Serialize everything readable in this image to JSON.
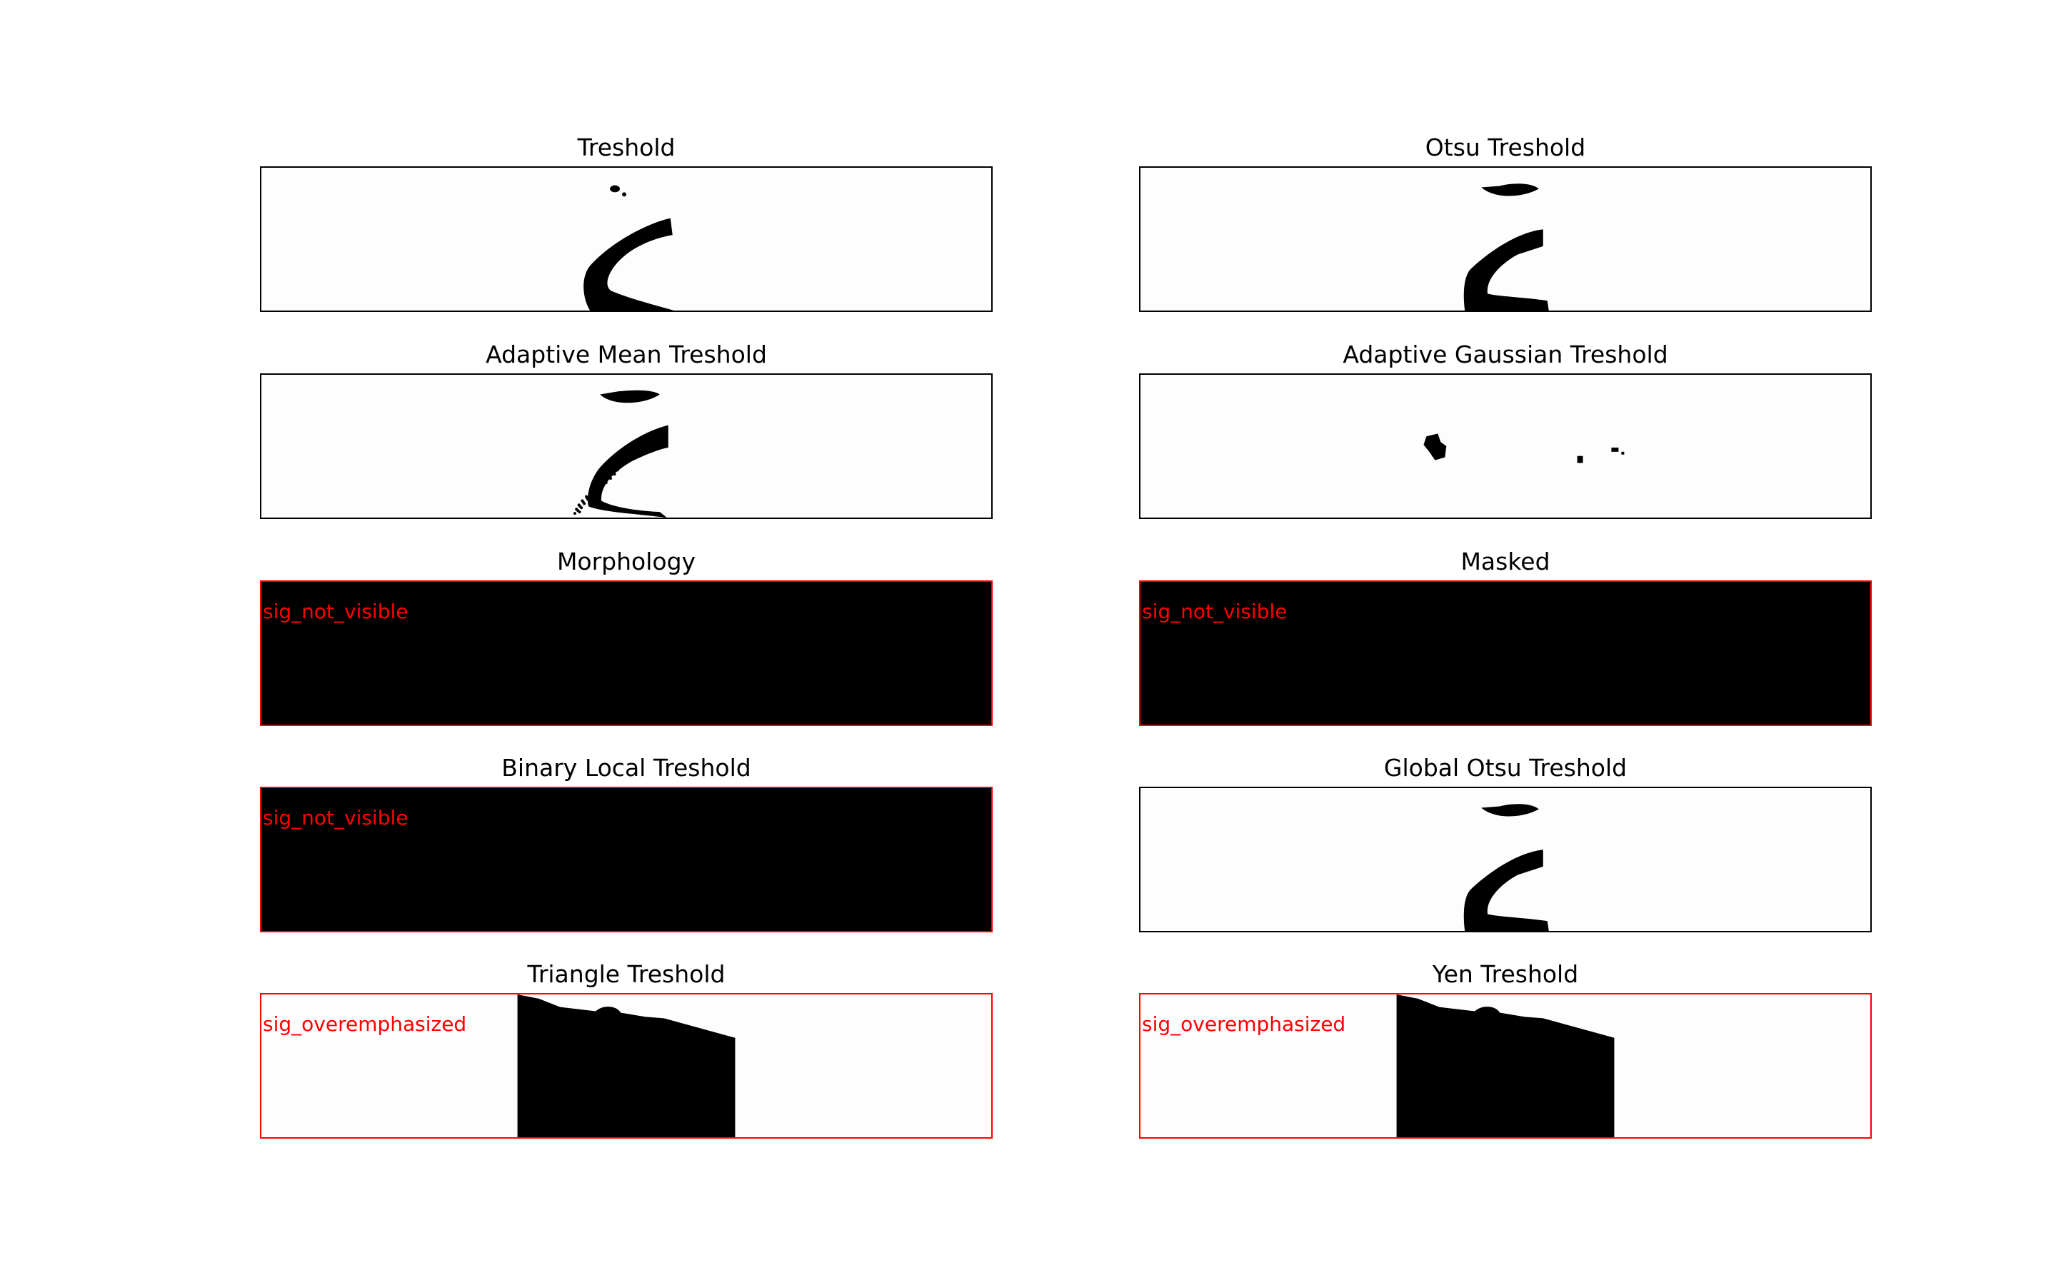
{
  "figure": {
    "background": "#ffffff",
    "flag_color": "#ff0000",
    "ok_color": "#000000"
  },
  "chart_data": {
    "type": "image-grid",
    "rows": 5,
    "cols": 2,
    "panels": [
      {
        "title": "Treshold",
        "label": "",
        "status": "ok",
        "content": "signature-thin-stroke"
      },
      {
        "title": "Otsu Treshold",
        "label": "",
        "status": "ok",
        "content": "signature-with-dot"
      },
      {
        "title": "Adaptive Mean Treshold",
        "label": "",
        "status": "ok",
        "content": "signature-speckled"
      },
      {
        "title": "Adaptive Gaussian Treshold",
        "label": "",
        "status": "ok",
        "content": "sparse-blobs"
      },
      {
        "title": "Morphology",
        "label": "sig_not_visible",
        "status": "flagged",
        "content": "all-black"
      },
      {
        "title": "Masked",
        "label": "sig_not_visible",
        "status": "flagged",
        "content": "all-black"
      },
      {
        "title": "Binary Local Treshold",
        "label": "sig_not_visible",
        "status": "flagged",
        "content": "all-black"
      },
      {
        "title": "Global Otsu Treshold",
        "label": "",
        "status": "ok",
        "content": "signature-with-dot"
      },
      {
        "title": "Triangle Treshold",
        "label": "sig_overemphasized",
        "status": "flagged",
        "content": "black-block"
      },
      {
        "title": "Yen Treshold",
        "label": "sig_overemphasized",
        "status": "flagged",
        "content": "black-block"
      }
    ]
  }
}
